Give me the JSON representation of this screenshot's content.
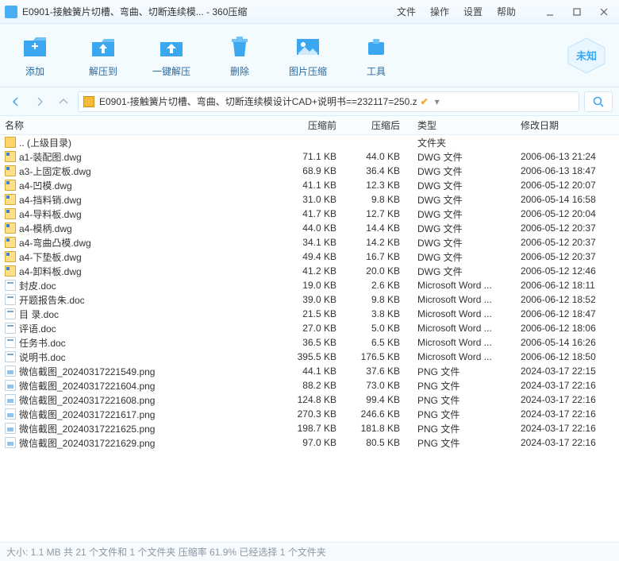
{
  "title": "E0901-接触簧片切槽、弯曲、切断连续模... - 360压缩",
  "menu": {
    "file": "文件",
    "operate": "操作",
    "settings": "设置",
    "help": "帮助"
  },
  "toolbar": {
    "add": "添加",
    "extract": "解压到",
    "oneclick": "一键解压",
    "delete": "删除",
    "imgcompress": "图片压缩",
    "tools": "工具"
  },
  "badge": "未知",
  "path": "E0901-接触簧片切槽、弯曲、切断连续模设计CAD+说明书==232117=250.z",
  "columns": {
    "name": "名称",
    "before": "压缩前",
    "after": "压缩后",
    "type": "类型",
    "date": "修改日期"
  },
  "parent": {
    "label": ".. (上级目录)",
    "type": "文件夹"
  },
  "files": [
    {
      "icon": "dwg",
      "name": "a1-装配图.dwg",
      "before": "71.1 KB",
      "after": "44.0 KB",
      "type": "DWG 文件",
      "date": "2006-06-13 21:24"
    },
    {
      "icon": "dwg",
      "name": "a3-上固定板.dwg",
      "before": "68.9 KB",
      "after": "36.4 KB",
      "type": "DWG 文件",
      "date": "2006-06-13 18:47"
    },
    {
      "icon": "dwg",
      "name": "a4-凹模.dwg",
      "before": "41.1 KB",
      "after": "12.3 KB",
      "type": "DWG 文件",
      "date": "2006-05-12 20:07"
    },
    {
      "icon": "dwg",
      "name": "a4-挡料销.dwg",
      "before": "31.0 KB",
      "after": "9.8 KB",
      "type": "DWG 文件",
      "date": "2006-05-14 16:58"
    },
    {
      "icon": "dwg",
      "name": "a4-导料板.dwg",
      "before": "41.7 KB",
      "after": "12.7 KB",
      "type": "DWG 文件",
      "date": "2006-05-12 20:04"
    },
    {
      "icon": "dwg",
      "name": "a4-模柄.dwg",
      "before": "44.0 KB",
      "after": "14.4 KB",
      "type": "DWG 文件",
      "date": "2006-05-12 20:37"
    },
    {
      "icon": "dwg",
      "name": "a4-弯曲凸模.dwg",
      "before": "34.1 KB",
      "after": "14.2 KB",
      "type": "DWG 文件",
      "date": "2006-05-12 20:37"
    },
    {
      "icon": "dwg",
      "name": "a4-下垫板.dwg",
      "before": "49.4 KB",
      "after": "16.7 KB",
      "type": "DWG 文件",
      "date": "2006-05-12 20:37"
    },
    {
      "icon": "dwg",
      "name": "a4-卸料板.dwg",
      "before": "41.2 KB",
      "after": "20.0 KB",
      "type": "DWG 文件",
      "date": "2006-05-12 12:46"
    },
    {
      "icon": "doc",
      "name": "封皮.doc",
      "before": "19.0 KB",
      "after": "2.6 KB",
      "type": "Microsoft Word ...",
      "date": "2006-06-12 18:11"
    },
    {
      "icon": "doc",
      "name": "开题报告朱.doc",
      "before": "39.0 KB",
      "after": "9.8 KB",
      "type": "Microsoft Word ...",
      "date": "2006-06-12 18:52"
    },
    {
      "icon": "doc",
      "name": "目  录.doc",
      "before": "21.5 KB",
      "after": "3.8 KB",
      "type": "Microsoft Word ...",
      "date": "2006-06-12 18:47"
    },
    {
      "icon": "doc",
      "name": "评语.doc",
      "before": "27.0 KB",
      "after": "5.0 KB",
      "type": "Microsoft Word ...",
      "date": "2006-06-12 18:06"
    },
    {
      "icon": "doc",
      "name": "任务书.doc",
      "before": "36.5 KB",
      "after": "6.5 KB",
      "type": "Microsoft Word ...",
      "date": "2006-05-14 16:26"
    },
    {
      "icon": "doc",
      "name": "说明书.doc",
      "before": "395.5 KB",
      "after": "176.5 KB",
      "type": "Microsoft Word ...",
      "date": "2006-06-12 18:50"
    },
    {
      "icon": "png",
      "name": "微信截图_20240317221549.png",
      "before": "44.1 KB",
      "after": "37.6 KB",
      "type": "PNG 文件",
      "date": "2024-03-17 22:15"
    },
    {
      "icon": "png",
      "name": "微信截图_20240317221604.png",
      "before": "88.2 KB",
      "after": "73.0 KB",
      "type": "PNG 文件",
      "date": "2024-03-17 22:16"
    },
    {
      "icon": "png",
      "name": "微信截图_20240317221608.png",
      "before": "124.8 KB",
      "after": "99.4 KB",
      "type": "PNG 文件",
      "date": "2024-03-17 22:16"
    },
    {
      "icon": "png",
      "name": "微信截图_20240317221617.png",
      "before": "270.3 KB",
      "after": "246.6 KB",
      "type": "PNG 文件",
      "date": "2024-03-17 22:16"
    },
    {
      "icon": "png",
      "name": "微信截图_20240317221625.png",
      "before": "198.7 KB",
      "after": "181.8 KB",
      "type": "PNG 文件",
      "date": "2024-03-17 22:16"
    },
    {
      "icon": "png",
      "name": "微信截图_20240317221629.png",
      "before": "97.0 KB",
      "after": "80.5 KB",
      "type": "PNG 文件",
      "date": "2024-03-17 22:16"
    }
  ],
  "status": "大小: 1.1 MB 共 21 个文件和 1 个文件夹 压缩率 61.9% 已经选择 1 个文件夹"
}
